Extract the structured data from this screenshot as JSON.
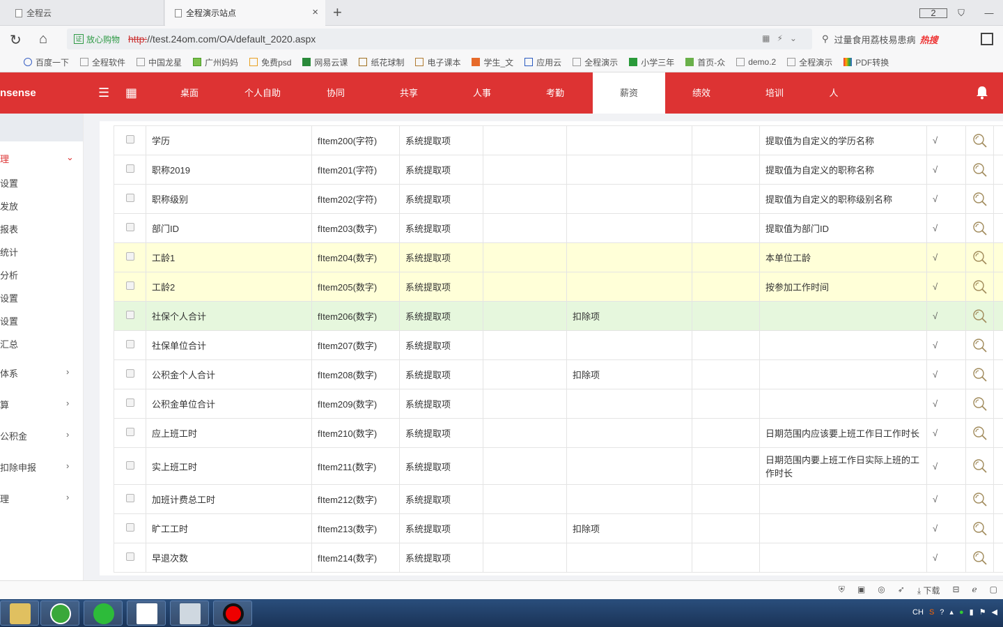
{
  "browser": {
    "tabs": [
      {
        "label": "全程云"
      },
      {
        "label": "全程演示站点"
      }
    ],
    "tab_count_badge": "2",
    "url_security_label": "放心购物",
    "url_security_badge": "证",
    "url_scheme": "http:",
    "url_rest": "//test.24om.com/OA/default_2020.aspx",
    "search_text": "过量食用荔枝易患病",
    "search_hot": "热搜"
  },
  "bookmarks": [
    {
      "label": "百度一下"
    },
    {
      "label": "全程软件"
    },
    {
      "label": "中国龙星"
    },
    {
      "label": "广州妈妈"
    },
    {
      "label": "免费psd"
    },
    {
      "label": "网易云课"
    },
    {
      "label": "纸花球制"
    },
    {
      "label": "电子课本"
    },
    {
      "label": "学生_文"
    },
    {
      "label": "应用云"
    },
    {
      "label": "全程演示"
    },
    {
      "label": "小学三年"
    },
    {
      "label": "首页-众"
    },
    {
      "label": "demo.2"
    },
    {
      "label": "全程演示"
    },
    {
      "label": "PDF转换"
    }
  ],
  "app": {
    "brand": "nsense",
    "nav": [
      {
        "label": "桌面"
      },
      {
        "label": "个人自助"
      },
      {
        "label": "协同"
      },
      {
        "label": "共享"
      },
      {
        "label": "人事"
      },
      {
        "label": "考勤"
      },
      {
        "label": "薪资"
      },
      {
        "label": "绩效"
      },
      {
        "label": "培训"
      },
      {
        "label": "人"
      }
    ]
  },
  "sidebar": {
    "items": [
      {
        "label": "理"
      },
      {
        "label": "设置"
      },
      {
        "label": "发放"
      },
      {
        "label": "报表"
      },
      {
        "label": "统计"
      },
      {
        "label": "分析"
      },
      {
        "label": "设置"
      },
      {
        "label": "设置"
      },
      {
        "label": "汇总"
      },
      {
        "label": "体系"
      },
      {
        "label": "算"
      },
      {
        "label": "公积金"
      },
      {
        "label": "扣除申报"
      },
      {
        "label": "理"
      }
    ]
  },
  "table": {
    "rows": [
      {
        "name": "学历",
        "field": "fItem200(字符)",
        "source": "系统提取项",
        "c4": "",
        "c5": "",
        "c6": "",
        "desc": "提取值为自定义的学历名称",
        "check": "√"
      },
      {
        "name": "职称2019",
        "field": "fItem201(字符)",
        "source": "系统提取项",
        "c4": "",
        "c5": "",
        "c6": "",
        "desc": "提取值为自定义的职称名称",
        "check": "√"
      },
      {
        "name": "职称级别",
        "field": "fItem202(字符)",
        "source": "系统提取项",
        "c4": "",
        "c5": "",
        "c6": "",
        "desc": "提取值为自定义的职称级别名称",
        "check": "√"
      },
      {
        "name": "部门ID",
        "field": "fItem203(数字)",
        "source": "系统提取项",
        "c4": "",
        "c5": "",
        "c6": "",
        "desc": "提取值为部门ID",
        "check": "√"
      },
      {
        "name": "工龄1",
        "field": "fItem204(数字)",
        "source": "系统提取项",
        "c4": "",
        "c5": "",
        "c6": "",
        "desc": "本单位工龄",
        "check": "√"
      },
      {
        "name": "工龄2",
        "field": "fItem205(数字)",
        "source": "系统提取项",
        "c4": "",
        "c5": "",
        "c6": "",
        "desc": "按参加工作时间",
        "check": "√"
      },
      {
        "name": "社保个人合计",
        "field": "fItem206(数字)",
        "source": "系统提取项",
        "c4": "",
        "c5": "扣除项",
        "c6": "",
        "desc": "",
        "check": "√"
      },
      {
        "name": "社保单位合计",
        "field": "fItem207(数字)",
        "source": "系统提取项",
        "c4": "",
        "c5": "",
        "c6": "",
        "desc": "",
        "check": "√"
      },
      {
        "name": "公积金个人合计",
        "field": "fItem208(数字)",
        "source": "系统提取项",
        "c4": "",
        "c5": "扣除项",
        "c6": "",
        "desc": "",
        "check": "√"
      },
      {
        "name": "公积金单位合计",
        "field": "fItem209(数字)",
        "source": "系统提取项",
        "c4": "",
        "c5": "",
        "c6": "",
        "desc": "",
        "check": "√"
      },
      {
        "name": "应上班工时",
        "field": "fItem210(数字)",
        "source": "系统提取项",
        "c4": "",
        "c5": "",
        "c6": "",
        "desc": "日期范围内应该要上班工作日工作时长",
        "check": "√"
      },
      {
        "name": "实上班工时",
        "field": "fItem211(数字)",
        "source": "系统提取项",
        "c4": "",
        "c5": "",
        "c6": "",
        "desc": "日期范围内要上班工作日实际上班的工作时长",
        "check": "√"
      },
      {
        "name": "加班计费总工时",
        "field": "fItem212(数字)",
        "source": "系统提取项",
        "c4": "",
        "c5": "",
        "c6": "",
        "desc": "",
        "check": "√"
      },
      {
        "name": "旷工工时",
        "field": "fItem213(数字)",
        "source": "系统提取项",
        "c4": "",
        "c5": "扣除项",
        "c6": "",
        "desc": "",
        "check": "√"
      },
      {
        "name": "早退次数",
        "field": "fItem214(数字)",
        "source": "系统提取项",
        "c4": "",
        "c5": "",
        "c6": "",
        "desc": "",
        "check": "√"
      }
    ]
  },
  "statusbar": {
    "download_label": "下载"
  },
  "taskbar": {
    "lang": "CH"
  },
  "colors": {
    "brand_red": "#dd3333",
    "row_yellow": "#ffffd8",
    "row_green": "#e6f7dd"
  }
}
